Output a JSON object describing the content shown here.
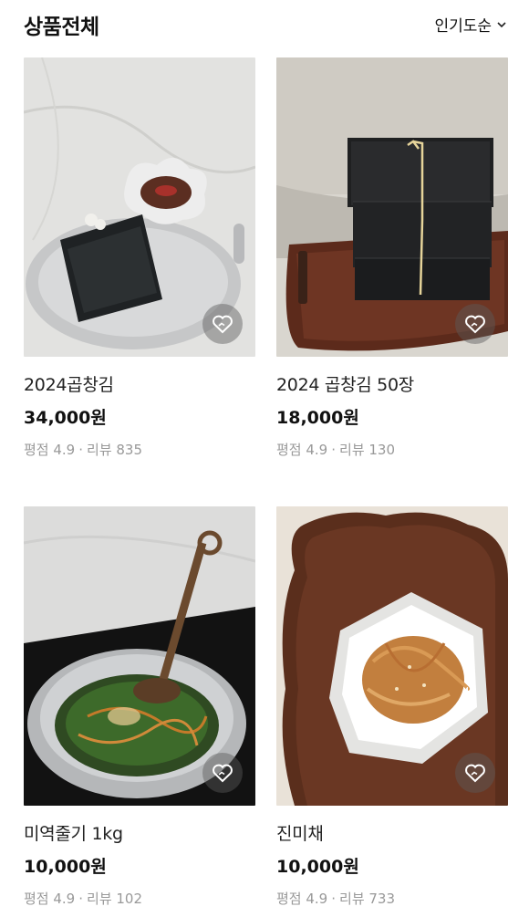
{
  "header": {
    "title": "상품전체",
    "sort_label": "인기도순"
  },
  "products": [
    {
      "name": "2024곱창김",
      "price": "34,000원",
      "rating_label": "평점 4.9",
      "review_label": "리뷰 835",
      "separator": "·"
    },
    {
      "name": "2024 곱창김 50장",
      "price": "18,000원",
      "rating_label": "평점 4.9",
      "review_label": "리뷰 130",
      "separator": "·"
    },
    {
      "name": "미역줄기 1kg",
      "price": "10,000원",
      "rating_label": "평점 4.9",
      "review_label": "리뷰 102",
      "separator": "·"
    },
    {
      "name": "진미채",
      "price": "10,000원",
      "rating_label": "평점 4.9",
      "review_label": "리뷰 733",
      "separator": "·"
    }
  ],
  "icons": {
    "sort": "chevron-down-icon",
    "wishlist": "heart-icon"
  }
}
